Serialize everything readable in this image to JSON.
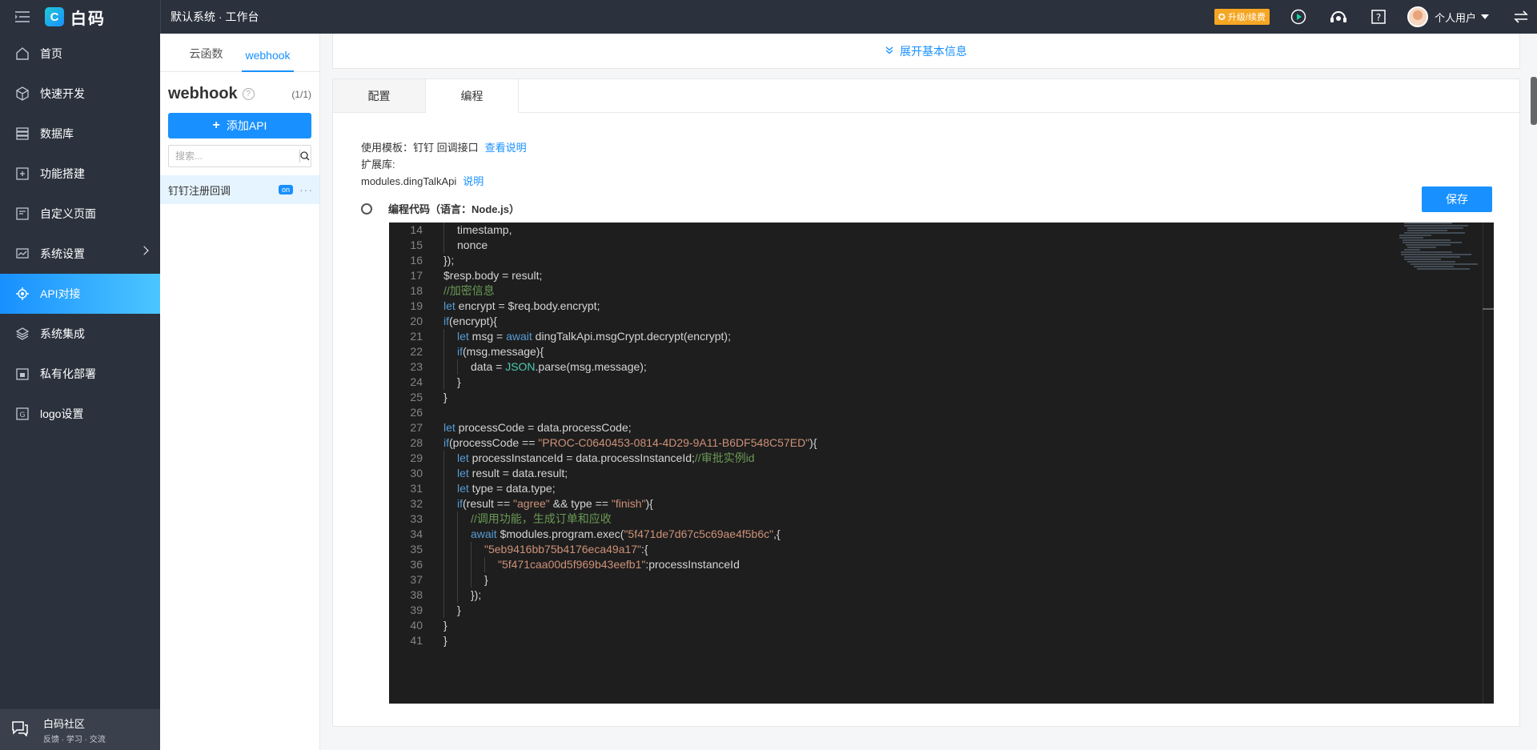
{
  "topbar": {
    "app_name": "白码",
    "workspace_title": "默认系统 · 工作台",
    "upgrade_label": "升级/续费",
    "user_name": "个人用户"
  },
  "sidebar": {
    "items": [
      {
        "label": "首页",
        "icon": "home-icon"
      },
      {
        "label": "快速开发",
        "icon": "cube-icon"
      },
      {
        "label": "数据库",
        "icon": "database-icon"
      },
      {
        "label": "功能搭建",
        "icon": "build-icon"
      },
      {
        "label": "自定义页面",
        "icon": "page-icon"
      },
      {
        "label": "系统设置",
        "icon": "settings-icon"
      },
      {
        "label": "API对接",
        "icon": "api-icon"
      },
      {
        "label": "系统集成",
        "icon": "layers-icon"
      },
      {
        "label": "私有化部署",
        "icon": "lock-icon"
      },
      {
        "label": "logo设置",
        "icon": "logo-icon"
      }
    ],
    "active": "API对接",
    "community": {
      "title": "白码社区",
      "subtitle": "反馈 · 学习 · 交流"
    }
  },
  "panel": {
    "tabs": [
      "云函数",
      "webhook"
    ],
    "active_tab": "webhook",
    "title": "webhook",
    "count": "(1/1)",
    "add_label": "添加API",
    "search_placeholder": "搜索...",
    "items": [
      {
        "name": "钉钉注册回调",
        "status": "on"
      }
    ]
  },
  "main": {
    "expand_label": "展开基本信息",
    "tabs": [
      "配置",
      "编程"
    ],
    "active_tab": "编程",
    "template_label": "使用模板：钉钉 回调接口",
    "template_link": "查看说明",
    "ext_label": "扩展库:",
    "ext_value": "modules.dingTalkApi",
    "ext_link": "说明",
    "code_label": "编程代码（语言：Node.js）",
    "save_label": "保存"
  },
  "colors": {
    "primary": "#1890ff",
    "sidebar_bg": "#2b313d",
    "editor_bg": "#1e1e1e",
    "upgrade": "#f5a623"
  }
}
